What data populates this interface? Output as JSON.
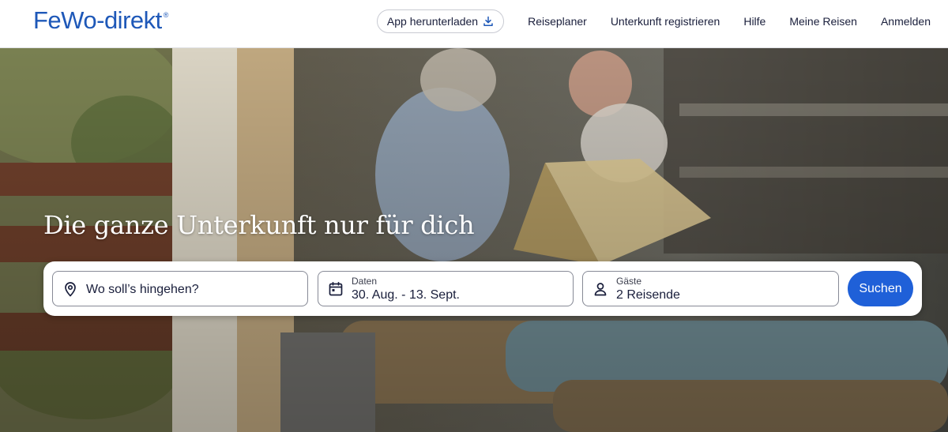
{
  "header": {
    "logo_text": "FeWo-direkt",
    "logo_mark": "®",
    "brand_color": "#1e58b8",
    "app_button_label": "App herunterladen",
    "nav": [
      {
        "label": "Reiseplaner"
      },
      {
        "label": "Unterkunft registrieren"
      },
      {
        "label": "Hilfe"
      },
      {
        "label": "Meine Reisen"
      },
      {
        "label": "Anmelden"
      }
    ]
  },
  "hero": {
    "headline": "Die ganze Unterkunft nur für dich"
  },
  "search": {
    "destination": {
      "placeholder": "Wo soll’s hingehen?",
      "icon": "location-pin-icon"
    },
    "dates": {
      "label": "Daten",
      "value": "30. Aug. - 13. Sept.",
      "icon": "calendar-icon"
    },
    "guests": {
      "label": "Gäste",
      "value": "2 Reisende",
      "icon": "person-icon"
    },
    "submit_label": "Suchen",
    "button_color": "#1f60d8"
  }
}
